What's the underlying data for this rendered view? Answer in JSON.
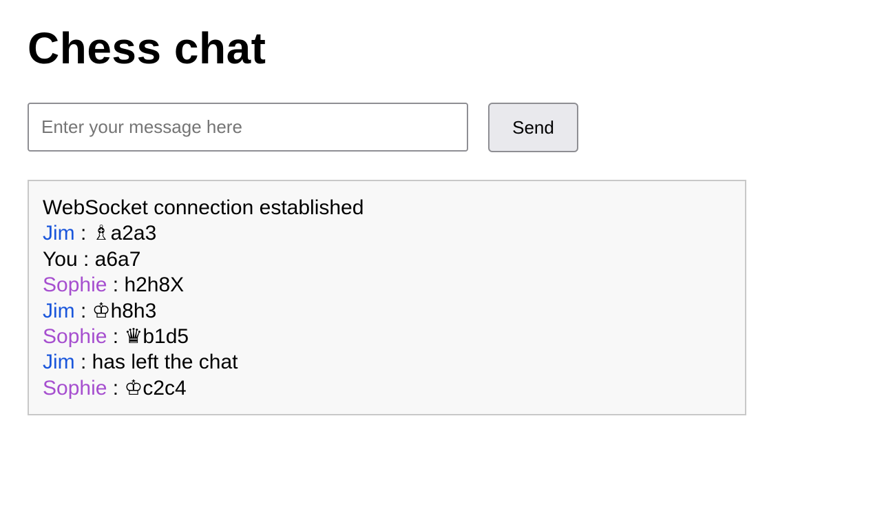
{
  "page": {
    "title": "Chess chat"
  },
  "composer": {
    "placeholder": "Enter your message here",
    "value": "",
    "send_label": "Send"
  },
  "colors": {
    "Jim": "#1a56db",
    "Sophie": "#a64fcf",
    "You": "#000000",
    "text": "#000000"
  },
  "log": {
    "lines": [
      {
        "kind": "system",
        "text": "WebSocket connection established"
      },
      {
        "kind": "message",
        "sender": "Jim",
        "separator": " : ",
        "text": "♗a2a3"
      },
      {
        "kind": "message",
        "sender": "You",
        "separator": " : ",
        "text": "a6a7"
      },
      {
        "kind": "message",
        "sender": "Sophie",
        "separator": " : ",
        "text": "h2h8X"
      },
      {
        "kind": "message",
        "sender": "Jim",
        "separator": " : ",
        "text": "♔h8h3"
      },
      {
        "kind": "message",
        "sender": "Sophie",
        "separator": " : ",
        "text": "♛b1d5"
      },
      {
        "kind": "message",
        "sender": "Jim",
        "separator": " : ",
        "text": "has left the chat"
      },
      {
        "kind": "message",
        "sender": "Sophie",
        "separator": " : ",
        "text": "♔c2c4"
      }
    ]
  }
}
